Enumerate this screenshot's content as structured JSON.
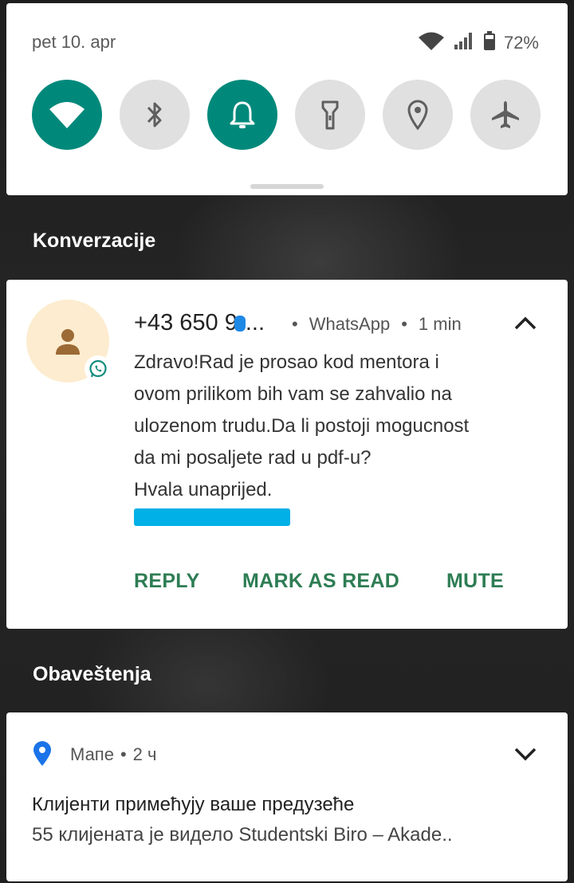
{
  "quick_settings": {
    "date": "pet 10. apr",
    "battery_percent": "72%",
    "tiles": [
      {
        "name": "wifi",
        "icon": "wifi-icon",
        "active": true
      },
      {
        "name": "bluetooth",
        "icon": "bluetooth-icon",
        "active": false
      },
      {
        "name": "sound",
        "icon": "bell-icon",
        "active": true
      },
      {
        "name": "flashlight",
        "icon": "flashlight-icon",
        "active": false
      },
      {
        "name": "location",
        "icon": "location-icon",
        "active": false
      },
      {
        "name": "airplane",
        "icon": "airplane-icon",
        "active": false
      }
    ]
  },
  "conversations": {
    "section_title": "Konverzacije",
    "notification": {
      "sender": "+43 650 9",
      "sender_ellipsis": "...",
      "app": "WhatsApp",
      "time": "1 min",
      "message": "Zdravo!Rad je prosao kod mentora i\novom prilikom bih vam se zahvalio na\nulozenom trudu.Da li postoji mogucnost\nda mi posaljete rad u pdf-u?\nHvala unaprijed.",
      "actions": {
        "reply": "REPLY",
        "mark_as_read": "MARK AS READ",
        "mute": "MUTE"
      }
    }
  },
  "notifications": {
    "section_title": "Obaveštenja",
    "maps": {
      "app": "Мапе",
      "time": "2 ч",
      "title": "Клијенти примећују ваше предузеће",
      "text": "55 клијената је видело Studentski Biro – Akade.."
    }
  },
  "colors": {
    "accent": "#00897b",
    "action_text": "#2e7d54",
    "redaction": "#00b0e6"
  }
}
